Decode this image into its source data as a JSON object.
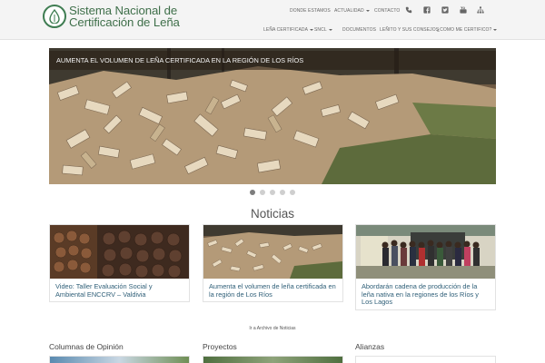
{
  "brand": {
    "line1": "Sistema Nacional de",
    "line2": "Certificación de Leña",
    "logo_icon": "leaf-drop-icon",
    "color": "#3f6f4a"
  },
  "topnav": {
    "items": [
      "DONDE ESTAMOS",
      "ACTUALIDAD",
      "CONTACTO"
    ],
    "social_icons": [
      "phone-icon",
      "facebook-icon",
      "twitter-icon",
      "youtube-icon",
      "sitemap-icon"
    ]
  },
  "subnav": {
    "items": [
      "LEÑA CERTIFICADA",
      "SNCL",
      "DOCUMENTOS",
      "LEÑITO Y SUS CONSEJOS",
      "¿COMO ME CERTIFICO?"
    ]
  },
  "hero": {
    "caption": "AUMENTA EL VOLUMEN DE LEÑA CERTIFICADA EN LA REGIÓN DE LOS RÍOS",
    "slide_count": 5,
    "active_slide": 1
  },
  "news": {
    "title": "Noticias",
    "cards": [
      {
        "title": "Video: Taller Evaluación Social y Ambiental ENCCRV – Valdivia"
      },
      {
        "title": "Aumenta el volumen de leña certificada en la región de Los Ríos"
      },
      {
        "title": "Abordarán cadena de producción de la leña nativa en la regiones de los Ríos y Los Lagos"
      }
    ],
    "archive_link": "Ir a Archivo de Noticias"
  },
  "columns": {
    "headings": [
      "Columnas de Opinión",
      "Proyectos",
      "Alianzas"
    ]
  },
  "colors": {
    "header_bg": "#f4f4f4",
    "link": "#2f5f78",
    "accent": "#3f7d52"
  }
}
